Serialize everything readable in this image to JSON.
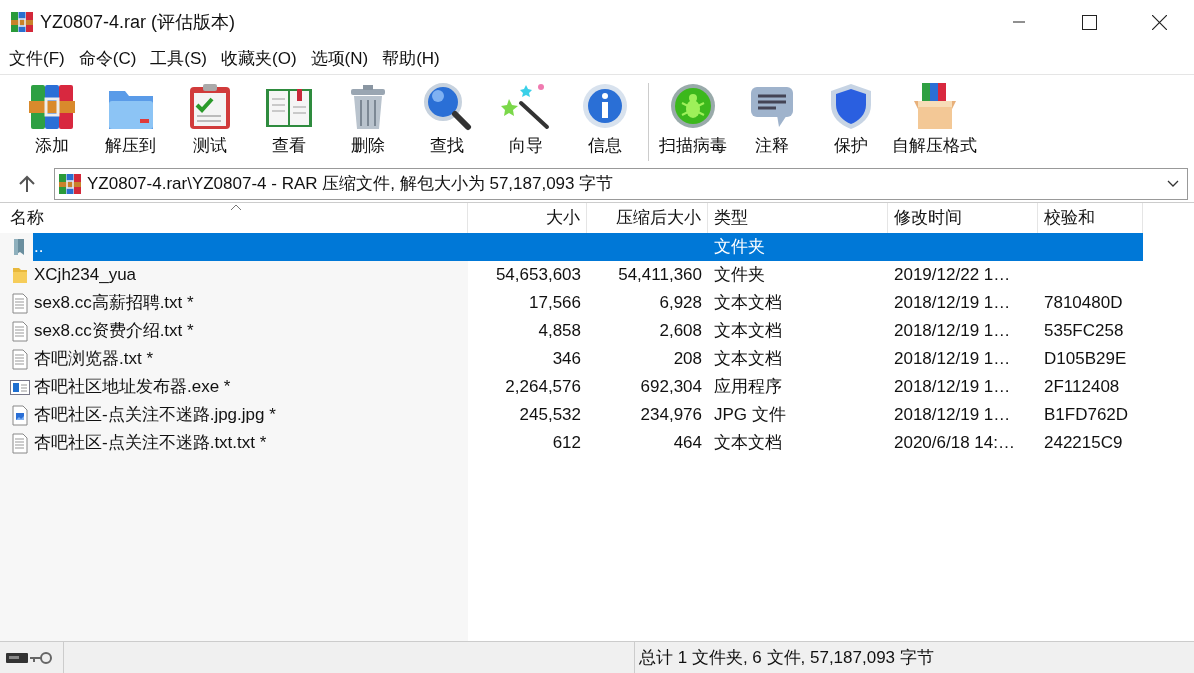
{
  "window": {
    "title": "YZ0807-4.rar (评估版本)"
  },
  "menu": [
    "文件(F)",
    "命令(C)",
    "工具(S)",
    "收藏夹(O)",
    "选项(N)",
    "帮助(H)"
  ],
  "toolbar_groups": [
    [
      {
        "label": "添加",
        "kind": "add"
      },
      {
        "label": "解压到",
        "kind": "extract"
      },
      {
        "label": "测试",
        "kind": "test"
      },
      {
        "label": "查看",
        "kind": "view"
      },
      {
        "label": "删除",
        "kind": "delete"
      },
      {
        "label": "查找",
        "kind": "find"
      },
      {
        "label": "向导",
        "kind": "wizard"
      },
      {
        "label": "信息",
        "kind": "info"
      }
    ],
    [
      {
        "label": "扫描病毒",
        "kind": "virus"
      },
      {
        "label": "注释",
        "kind": "comment"
      },
      {
        "label": "保护",
        "kind": "protect"
      },
      {
        "label": "自解压格式",
        "kind": "sfx"
      }
    ]
  ],
  "address": {
    "path": "YZ0807-4.rar\\YZ0807-4 - RAR 压缩文件, 解包大小为 57,187,093 字节"
  },
  "table": {
    "columns": [
      "名称",
      "大小",
      "压缩后大小",
      "类型",
      "修改时间",
      "校验和"
    ],
    "rows": [
      {
        "kind": "up",
        "name": "..",
        "size": "",
        "packed": "",
        "type": "文件夹",
        "modified": "",
        "crc": "",
        "selected": true
      },
      {
        "kind": "folder",
        "name": "XCjh234_yua",
        "size": "54,653,603",
        "packed": "54,411,360",
        "type": "文件夹",
        "modified": "2019/12/22 1…",
        "crc": "",
        "selected": false
      },
      {
        "kind": "text",
        "name": "sex8.cc高薪招聘.txt *",
        "size": "17,566",
        "packed": "6,928",
        "type": "文本文档",
        "modified": "2018/12/19 1…",
        "crc": "7810480D",
        "selected": false
      },
      {
        "kind": "text",
        "name": "sex8.cc资费介绍.txt *",
        "size": "4,858",
        "packed": "2,608",
        "type": "文本文档",
        "modified": "2018/12/19 1…",
        "crc": "535FC258",
        "selected": false
      },
      {
        "kind": "text",
        "name": "杏吧浏览器.txt *",
        "size": "346",
        "packed": "208",
        "type": "文本文档",
        "modified": "2018/12/19 1…",
        "crc": "D105B29E",
        "selected": false
      },
      {
        "kind": "exe",
        "name": "杏吧社区地址发布器.exe *",
        "size": "2,264,576",
        "packed": "692,304",
        "type": "应用程序",
        "modified": "2018/12/19 1…",
        "crc": "2F112408",
        "selected": false
      },
      {
        "kind": "image",
        "name": "杏吧社区-点关注不迷路.jpg.jpg *",
        "size": "245,532",
        "packed": "234,976",
        "type": "JPG 文件",
        "modified": "2018/12/19 1…",
        "crc": "B1FD762D",
        "selected": false
      },
      {
        "kind": "text",
        "name": "杏吧社区-点关注不迷路.txt.txt *",
        "size": "612",
        "packed": "464",
        "type": "文本文档",
        "modified": "2020/6/18 14:…",
        "crc": "242215C9",
        "selected": false
      }
    ]
  },
  "status_bar": {
    "summary": "总计 1 文件夹, 6 文件, 57,187,093 字节"
  }
}
